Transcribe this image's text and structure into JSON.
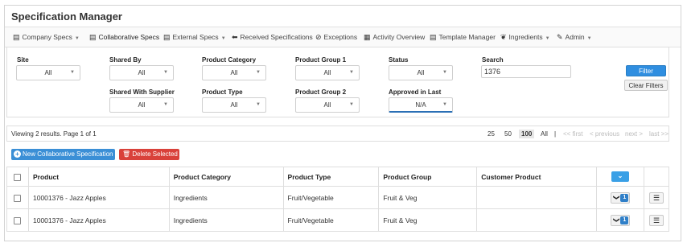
{
  "app": {
    "title": "Specification Manager"
  },
  "nav": [
    {
      "label": "Company Specs",
      "icon": "stack-icon",
      "glyph": "▤",
      "caret": true,
      "active": false
    },
    {
      "label": "Collaborative Specs",
      "icon": "stack-icon",
      "glyph": "▤",
      "caret": false,
      "active": true
    },
    {
      "label": "External Specs",
      "icon": "stack-icon",
      "glyph": "▤",
      "caret": true,
      "active": false
    },
    {
      "label": "Received Specifications",
      "icon": "arrow-left-icon",
      "glyph": "⬅",
      "caret": false,
      "active": false
    },
    {
      "label": "Exceptions",
      "icon": "ban-icon",
      "glyph": "⊘",
      "caret": false,
      "active": false
    },
    {
      "label": "Activity Overview",
      "icon": "table-icon",
      "glyph": "▦",
      "caret": false,
      "active": false
    },
    {
      "label": "Template Manager",
      "icon": "document-icon",
      "glyph": "▤",
      "caret": false,
      "active": false
    },
    {
      "label": "Ingredients",
      "icon": "leaf-icon",
      "glyph": "❦",
      "caret": true,
      "active": false
    },
    {
      "label": "Admin",
      "icon": "wrench-icon",
      "glyph": "✎",
      "caret": true,
      "active": false
    }
  ],
  "filters": {
    "site": {
      "label": "Site",
      "value": "All"
    },
    "shared_by": {
      "label": "Shared By",
      "value": "All"
    },
    "product_category": {
      "label": "Product Category",
      "value": "All"
    },
    "product_group_1": {
      "label": "Product Group 1",
      "value": "All"
    },
    "status": {
      "label": "Status",
      "value": "All"
    },
    "search": {
      "label": "Search",
      "value": "1376"
    },
    "shared_with_supplier": {
      "label": "Shared With Supplier",
      "value": "All"
    },
    "product_type": {
      "label": "Product Type",
      "value": "All"
    },
    "product_group_2": {
      "label": "Product Group 2",
      "value": "All"
    },
    "approved_in_last": {
      "label": "Approved in Last",
      "value": "N/A"
    },
    "filter_button": "Filter",
    "clear_button": "Clear Filters"
  },
  "pagination": {
    "info": "Viewing 2 results. Page 1 of 1",
    "sizes": [
      "25",
      "50",
      "100",
      "All"
    ],
    "selected_size": "100",
    "separator": "|",
    "first": "<< first",
    "previous": "< previous",
    "next": "next >",
    "last": "last >>"
  },
  "actions": {
    "new_label": "New Collaborative Specification",
    "delete_label": "Delete Selected"
  },
  "table": {
    "columns": [
      "Product",
      "Product Category",
      "Product Type",
      "Product Group",
      "Customer Product"
    ],
    "rows": [
      {
        "product": "10001376 - Jazz Apples",
        "category": "Ingredients",
        "type": "Fruit/Vegetable",
        "group": "Fruit & Veg",
        "customer_product": "",
        "badge": "1"
      },
      {
        "product": "10001376 - Jazz Apples",
        "category": "Ingredients",
        "type": "Fruit/Vegetable",
        "group": "Fruit & Veg",
        "customer_product": "",
        "badge": "1"
      }
    ]
  },
  "colors": {
    "accent": "#3a8dd8",
    "filter_button": "#2f8ee0",
    "new_button": "#3b8fd6",
    "delete_button": "#d9413a",
    "badge": "#2f7fc8"
  }
}
